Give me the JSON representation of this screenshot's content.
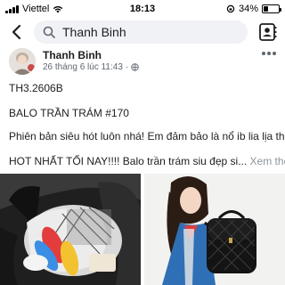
{
  "status_bar": {
    "carrier": "Viettel",
    "time": "18:13",
    "battery_percent": "34%",
    "battery_level": 0.34
  },
  "search": {
    "query": "Thanh Binh",
    "icons": [
      "chevron-left-icon",
      "search-icon",
      "profile-card-icon"
    ]
  },
  "post": {
    "author": "Thanh Binh",
    "timestamp": "26 tháng 6 lúc 11:43",
    "separator": "·",
    "lines": [
      "TH3.2606B",
      "BALO TRẦN TRÁM #170",
      "Phiên bản siêu hót luôn nhá! Em đảm bảo là nổ ib lia lịa thội",
      "HOT NHẤT TỐI NAY!!!! Balo trần trám siu đẹp si..."
    ],
    "see_more": "Xem thêm"
  },
  "colors": {
    "accent": "#1877f2",
    "muted_text": "#606770",
    "search_bg": "#f0f2f5"
  }
}
